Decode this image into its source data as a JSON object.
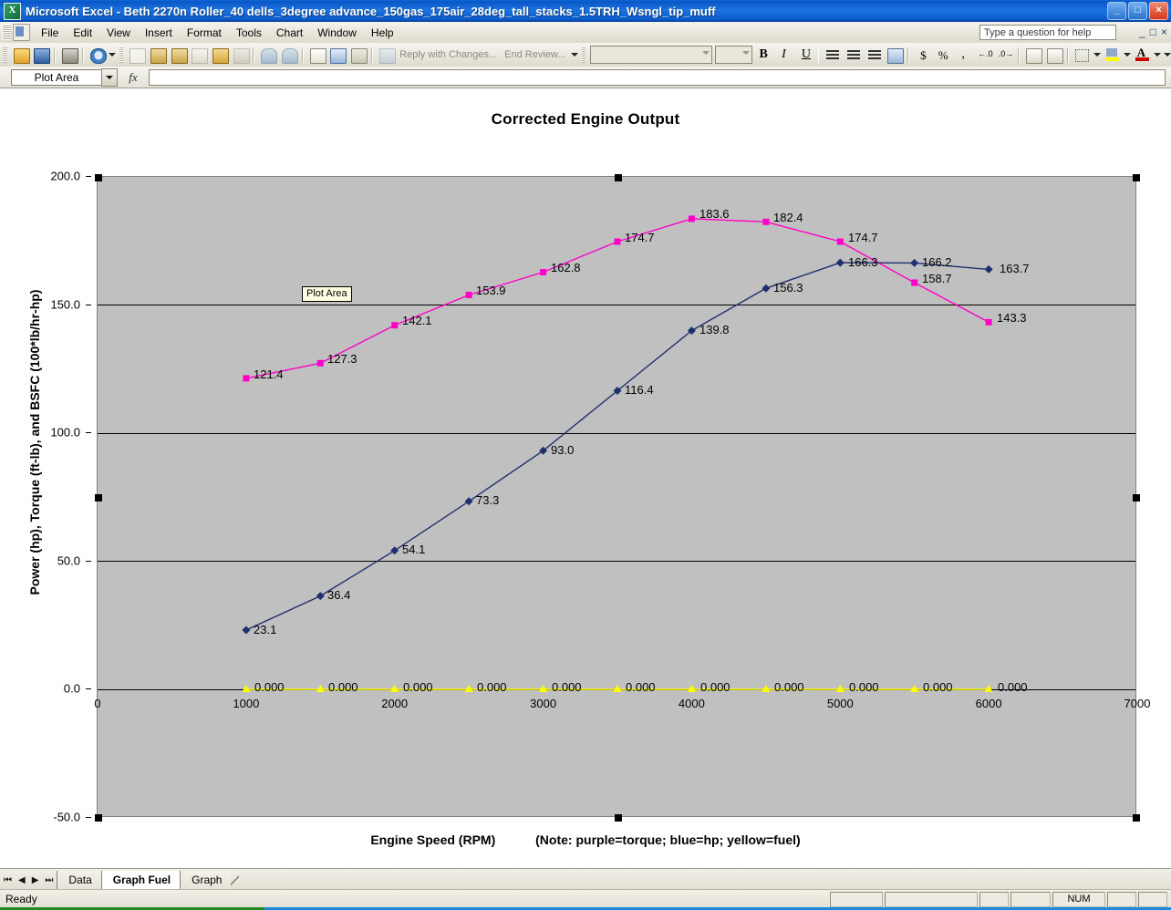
{
  "window": {
    "title": "Microsoft Excel - Beth 2270n Roller_40 dells_3degree advance_150gas_175air_28deg_tall_stacks_1.5TRH_Wsngl_tip_muff",
    "logo": "X",
    "minimize": "_",
    "restore": "□",
    "close": "×"
  },
  "menu": {
    "items": [
      "File",
      "Edit",
      "View",
      "Insert",
      "Format",
      "Tools",
      "Chart",
      "Window",
      "Help"
    ],
    "help_placeholder": "Type a question for help",
    "mini_minimize": "_",
    "mini_restore": "□",
    "mini_close": "×"
  },
  "toolbar": {
    "review_label": "Reply with Changes...",
    "end_review_label": "End Review..."
  },
  "formula_bar": {
    "name_box_value": "Plot Area",
    "fx_label": "fx",
    "formula_value": ""
  },
  "chart": {
    "title": "Corrected Engine Output",
    "x_axis_title": "Engine Speed (RPM)",
    "x_axis_note": "(Note: purple=torque; blue=hp; yellow=fuel)",
    "y_axis_title": "Power (hp), Torque (ft-lb), and BSFC (100*lb/hr-hp)",
    "tooltip": "Plot Area",
    "plot_bg": "#c0c0c0",
    "colors": {
      "torque": "#ff00c8",
      "power": "#1f2f6e",
      "fuel": "#ffff00",
      "gridline": "#000000"
    }
  },
  "chart_data": {
    "type": "line",
    "title": "Corrected Engine Output",
    "xlabel": "Engine Speed (RPM)",
    "ylabel": "Power (hp), Torque (ft-lb), and BSFC (100*lb/hr-hp)",
    "xlim": [
      0,
      7000
    ],
    "ylim": [
      -50,
      200
    ],
    "xticks": [
      0,
      1000,
      2000,
      3000,
      4000,
      5000,
      6000,
      7000
    ],
    "xticklabels": [
      "0",
      "1000",
      "2000",
      "3000",
      "4000",
      "5000",
      "6000",
      "7000"
    ],
    "yticks": [
      -50,
      0,
      50,
      100,
      150,
      200
    ],
    "yticklabels": [
      "-50.0",
      "0.0",
      "50.0",
      "100.0",
      "150.0",
      "200.0"
    ],
    "grid": true,
    "legend": "none",
    "x": [
      1000,
      1500,
      2000,
      2500,
      3000,
      3500,
      4000,
      4500,
      5000,
      5500,
      6000
    ],
    "series": [
      {
        "name": "Torque (ft-lb)",
        "color": "#ff00c8",
        "marker": "square",
        "values": [
          121.4,
          127.3,
          142.1,
          153.9,
          162.8,
          174.7,
          183.6,
          182.4,
          174.7,
          158.7,
          143.3
        ],
        "labels": [
          "121.4",
          "127.3",
          "142.1",
          "153.9",
          "162.8",
          "174.7",
          "183.6",
          "182.4",
          "174.7",
          "158.7",
          "143.3"
        ]
      },
      {
        "name": "Power (hp)",
        "color": "#1f2f6e",
        "marker": "diamond",
        "values": [
          23.1,
          36.4,
          54.1,
          73.3,
          93.0,
          116.4,
          139.8,
          156.3,
          166.3,
          166.2,
          163.7
        ],
        "labels": [
          "23.1",
          "36.4",
          "54.1",
          "73.3",
          "93.0",
          "116.4",
          "139.8",
          "156.3",
          "166.3",
          "166.2",
          "163.7"
        ]
      },
      {
        "name": "BSFC fuel (100*lb/hr-hp)",
        "color": "#ffff00",
        "marker": "triangle",
        "values": [
          0,
          0,
          0,
          0,
          0,
          0,
          0,
          0,
          0,
          0,
          0
        ],
        "labels": [
          "0.000",
          "0.000",
          "0.000",
          "0.000",
          "0.000",
          "0.000",
          "0.000",
          "0.000",
          "0.000",
          "0.000",
          "0.000"
        ]
      }
    ]
  },
  "sheet_tabs": {
    "first": "⏮",
    "prev": "◀",
    "next": "▶",
    "last": "⏭",
    "tabs": [
      {
        "label": "Data",
        "active": false
      },
      {
        "label": "Graph Fuel",
        "active": true
      },
      {
        "label": "Graph",
        "active": false
      }
    ]
  },
  "status_bar": {
    "message": "Ready",
    "num_lock": "NUM"
  }
}
